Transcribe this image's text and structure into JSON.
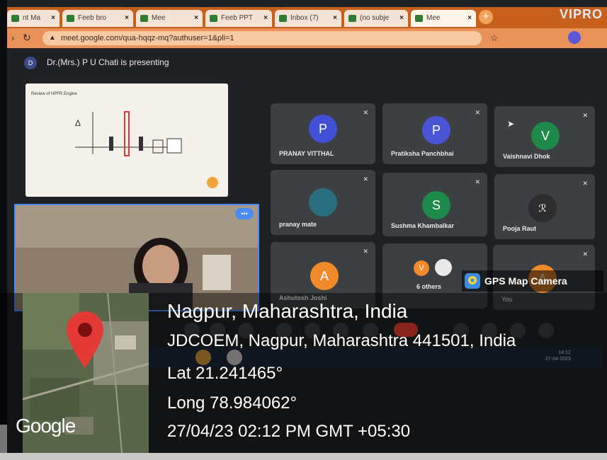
{
  "browser": {
    "tabs": [
      {
        "label": "nt Ma"
      },
      {
        "label": "Feeb bro"
      },
      {
        "label": "Mee"
      },
      {
        "label": "Feeb PPT"
      },
      {
        "label": "Inbox (7)"
      },
      {
        "label": "(no subje"
      },
      {
        "label": "Mee"
      }
    ],
    "url": "meet.google.com/qua-hqqz-mq?authuser=1&pli=1",
    "brand": "VIPRO"
  },
  "meet": {
    "presenter_initial": "D",
    "presenter_text": "Dr.(Mrs.) P U Chati is presenting",
    "slide_title": "Review of HPFR Engine",
    "participants": [
      {
        "name": "PRANAY VITTHAL",
        "initial": "P",
        "color": "#4250d8"
      },
      {
        "name": "Pratiksha Panchbhai",
        "initial": "P",
        "color": "#4a55d6"
      },
      {
        "name": "Vaishnavi Dhok",
        "initial": "V",
        "color": "#1e8a4a"
      },
      {
        "name": "pranay mate",
        "initial": "",
        "color": "#2a6e80"
      },
      {
        "name": "Sushma Khambalkar",
        "initial": "S",
        "color": "#1d8a4c"
      },
      {
        "name": "Pooja Raut",
        "initial": "",
        "color": "#2d2d2d"
      },
      {
        "name": "Ashutosh Joshi",
        "initial": "A",
        "color": "#f08a2a"
      },
      {
        "name": "6 others",
        "initial": "V",
        "color": "#f08a2a"
      },
      {
        "name": "You",
        "initial": "A",
        "color": "#f08a2a"
      }
    ],
    "taskbar_time": "14:12",
    "taskbar_date": "27-04-2023"
  },
  "gps": {
    "label": "GPS Map Camera",
    "city": "Nagpur, Maharashtra, India",
    "address": "JDCOEM, Nagpur, Maharashtra 441501, India",
    "lat": "Lat 21.241465°",
    "long": "Long 78.984062°",
    "timestamp": "27/04/23 02:12 PM GMT +05:30",
    "map_brand": "Google"
  }
}
